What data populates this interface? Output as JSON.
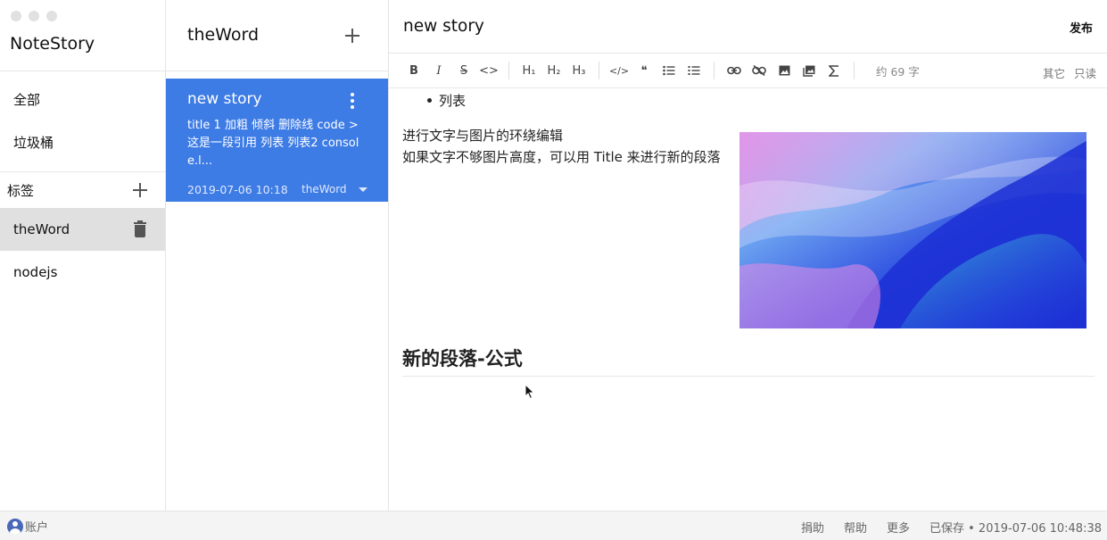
{
  "app": {
    "title": "NoteStory"
  },
  "sidebar": {
    "items": [
      {
        "label": "全部"
      },
      {
        "label": "垃圾桶"
      }
    ],
    "tags_header": "标签",
    "tags": [
      {
        "label": "theWord",
        "active": true
      },
      {
        "label": "nodejs",
        "active": false
      }
    ]
  },
  "notebook": {
    "title": "theWord",
    "notes": [
      {
        "title": "new story",
        "excerpt": "title 1 加粗 倾斜 删除线 code > 这是一段引用 列表 列表2 console.l...",
        "date": "2019-07-06 10:18",
        "tag": "theWord"
      }
    ]
  },
  "editor": {
    "title": "new story",
    "publish_label": "发布",
    "toolbar": {
      "bold": "B",
      "italic": "I",
      "strikethrough": "S",
      "code_inline": "<>",
      "h1": "H₁",
      "h2": "H₂",
      "h3": "H₃",
      "code_block": "</>",
      "quote": "❝",
      "word_count": "约 69 字",
      "other_label": "其它",
      "readonly_label": "只读"
    },
    "content": {
      "bullet": "列表",
      "paragraph_line1": "进行文字与图片的环绕编辑",
      "paragraph_line2": "如果文字不够图片高度，可以用 Title 来进行新的段落",
      "heading": "新的段落-公式"
    }
  },
  "statusbar": {
    "account_label": "账户",
    "links": [
      "捐助",
      "帮助",
      "更多"
    ],
    "saved_text": "已保存 • 2019-07-06 10:48:38"
  },
  "colors": {
    "accent": "#3d7be5",
    "active_tag_bg": "#e0e0e0",
    "statusbar_bg": "#f4f4f4"
  }
}
